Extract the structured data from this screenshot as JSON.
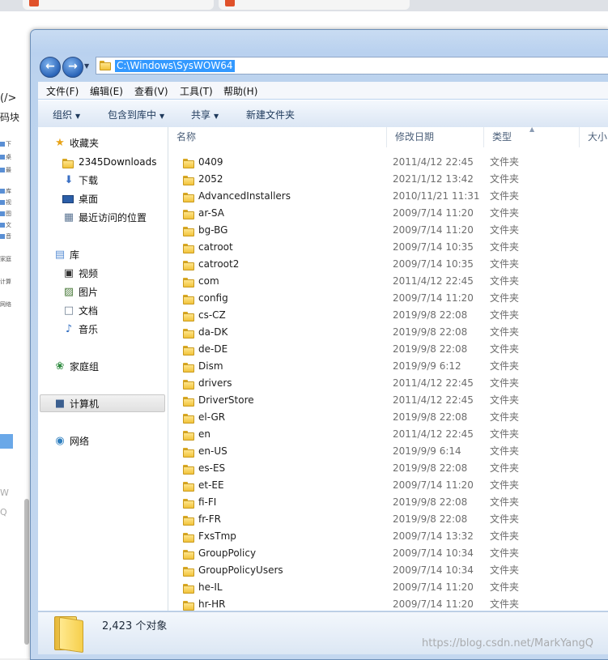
{
  "explorer": {
    "address_path": "C:\\Windows\\SysWOW64",
    "menu": [
      "文件(F)",
      "编辑(E)",
      "查看(V)",
      "工具(T)",
      "帮助(H)"
    ],
    "toolbar": {
      "organize": "组织",
      "include_in_library": "包含到库中",
      "share": "共享",
      "new_folder": "新建文件夹"
    },
    "nav": {
      "favorites": "收藏夹",
      "fav_items": [
        "2345Downloads",
        "下载",
        "桌面",
        "最近访问的位置"
      ],
      "libraries": "库",
      "lib_items": [
        "视频",
        "图片",
        "文档",
        "音乐"
      ],
      "homegroup": "家庭组",
      "computer": "计算机",
      "network": "网络"
    },
    "columns": {
      "name": "名称",
      "modified": "修改日期",
      "type": "类型",
      "size": "大小"
    },
    "files": [
      {
        "name": "0409",
        "modified": "2011/4/12 22:45",
        "type": "文件夹"
      },
      {
        "name": "2052",
        "modified": "2021/1/12 13:42",
        "type": "文件夹"
      },
      {
        "name": "AdvancedInstallers",
        "modified": "2010/11/21 11:31",
        "type": "文件夹"
      },
      {
        "name": "ar-SA",
        "modified": "2009/7/14 11:20",
        "type": "文件夹"
      },
      {
        "name": "bg-BG",
        "modified": "2009/7/14 11:20",
        "type": "文件夹"
      },
      {
        "name": "catroot",
        "modified": "2009/7/14 10:35",
        "type": "文件夹"
      },
      {
        "name": "catroot2",
        "modified": "2009/7/14 10:35",
        "type": "文件夹"
      },
      {
        "name": "com",
        "modified": "2011/4/12 22:45",
        "type": "文件夹"
      },
      {
        "name": "config",
        "modified": "2009/7/14 11:20",
        "type": "文件夹"
      },
      {
        "name": "cs-CZ",
        "modified": "2019/9/8 22:08",
        "type": "文件夹"
      },
      {
        "name": "da-DK",
        "modified": "2019/9/8 22:08",
        "type": "文件夹"
      },
      {
        "name": "de-DE",
        "modified": "2019/9/8 22:08",
        "type": "文件夹"
      },
      {
        "name": "Dism",
        "modified": "2019/9/9 6:12",
        "type": "文件夹"
      },
      {
        "name": "drivers",
        "modified": "2011/4/12 22:45",
        "type": "文件夹"
      },
      {
        "name": "DriverStore",
        "modified": "2011/4/12 22:45",
        "type": "文件夹"
      },
      {
        "name": "el-GR",
        "modified": "2019/9/8 22:08",
        "type": "文件夹"
      },
      {
        "name": "en",
        "modified": "2011/4/12 22:45",
        "type": "文件夹"
      },
      {
        "name": "en-US",
        "modified": "2019/9/9 6:14",
        "type": "文件夹"
      },
      {
        "name": "es-ES",
        "modified": "2019/9/8 22:08",
        "type": "文件夹"
      },
      {
        "name": "et-EE",
        "modified": "2009/7/14 11:20",
        "type": "文件夹"
      },
      {
        "name": "fi-FI",
        "modified": "2019/9/8 22:08",
        "type": "文件夹"
      },
      {
        "name": "fr-FR",
        "modified": "2019/9/8 22:08",
        "type": "文件夹"
      },
      {
        "name": "FxsTmp",
        "modified": "2009/7/14 13:32",
        "type": "文件夹"
      },
      {
        "name": "GroupPolicy",
        "modified": "2009/7/14 10:34",
        "type": "文件夹"
      },
      {
        "name": "GroupPolicyUsers",
        "modified": "2009/7/14 10:34",
        "type": "文件夹"
      },
      {
        "name": "he-IL",
        "modified": "2009/7/14 11:20",
        "type": "文件夹"
      },
      {
        "name": "hr-HR",
        "modified": "2009/7/14 11:20",
        "type": "文件夹"
      }
    ],
    "status": {
      "count": "2,423 个对象",
      "watermark": "https://blog.csdn.net/MarkYangQ"
    }
  },
  "background": {
    "left_text_1": "(/>",
    "left_text_2": "码块",
    "mini_labels": [
      "下",
      "桌",
      "最",
      "库",
      "视",
      "图",
      "文",
      "音",
      "家庭",
      "计算",
      "网络"
    ],
    "bottom_letters": [
      "W",
      "Q"
    ]
  }
}
